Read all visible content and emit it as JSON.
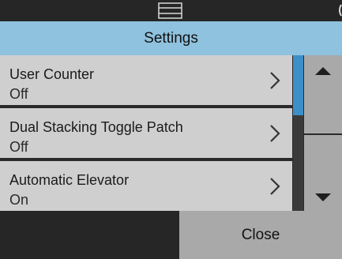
{
  "header": {
    "title": "Settings"
  },
  "settings": {
    "items": [
      {
        "label": "User Counter",
        "value": "Off"
      },
      {
        "label": "Dual Stacking Toggle Patch",
        "value": "Off"
      },
      {
        "label": "Automatic Elevator",
        "value": "On"
      }
    ]
  },
  "footer": {
    "close_label": "Close"
  },
  "icons": {
    "status": "scanner-status-icon",
    "chevron": "chevron-right-icon",
    "up": "arrow-up-icon",
    "down": "arrow-down-icon"
  },
  "colors": {
    "title_bar": "#8fc2de",
    "item_bg": "#cfcfcf",
    "scroll_indicator": "#3d8fc9",
    "button_bg": "#a9a9a9",
    "background": "#2a2a2a"
  }
}
